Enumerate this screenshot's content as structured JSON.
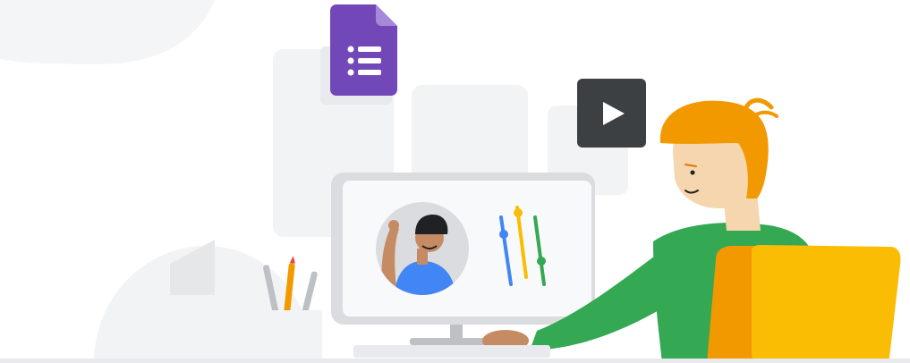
{
  "illustration": {
    "kind": "online-learning-hero-illustration",
    "colors": {
      "background": "#ffffff",
      "backdrop_panel": "#f1f3f4",
      "blob": "#f4f5f6",
      "forms_purple": "#7248b9",
      "forms_purple_fold": "#a688d8",
      "video_dark": "#3c4043",
      "monitor_frame": "#dadce0",
      "monitor_screen": "#f8f9fa",
      "hair_orange": "#f29900",
      "skin": "#f6d6ae",
      "shirt_green": "#34a853",
      "chair_yellow": "#fbbc04",
      "chair_orange": "#f29900",
      "student_shirt_blue": "#4285f4",
      "student_skin": "#c58c63",
      "slider_blue": "#4285f4",
      "slider_yellow": "#fbbc04",
      "slider_green": "#34a853",
      "floor_line": "#e8eaed"
    },
    "icons": [
      "google-forms-icon",
      "play-video-icon",
      "pencil-cup-icon",
      "equalizer-sliders-icon",
      "video-call-student-avatar"
    ]
  }
}
